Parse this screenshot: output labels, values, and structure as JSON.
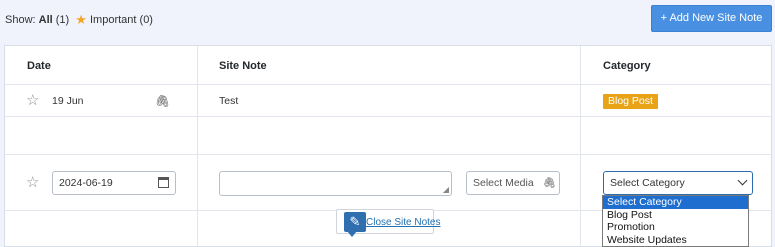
{
  "filters": {
    "show_label": "Show:",
    "all_label": "All",
    "all_count": "(1)",
    "important_label": "Important",
    "important_count": "(0)"
  },
  "add_button": {
    "label": "+ Add New Site Note"
  },
  "table": {
    "headers": {
      "date": "Date",
      "site_note": "Site Note",
      "category": "Category"
    },
    "rows": [
      {
        "date": "19 Jun",
        "note": "Test",
        "category": "Blog Post",
        "category_color": "#e8a317"
      }
    ]
  },
  "new_note": {
    "date_value": "2024-06-19",
    "note_placeholder": "",
    "media_label": "Select Media",
    "category_selected": "Select Category",
    "category_options": [
      "Select Category",
      "Blog Post",
      "Promotion",
      "Website Updates"
    ]
  },
  "close_link": {
    "label": "Close Site Notes"
  },
  "colors": {
    "primary_button": "#4a90e2",
    "badge": "#e8a317",
    "link": "#2271b1",
    "selected_option": "#1e6ed0"
  }
}
